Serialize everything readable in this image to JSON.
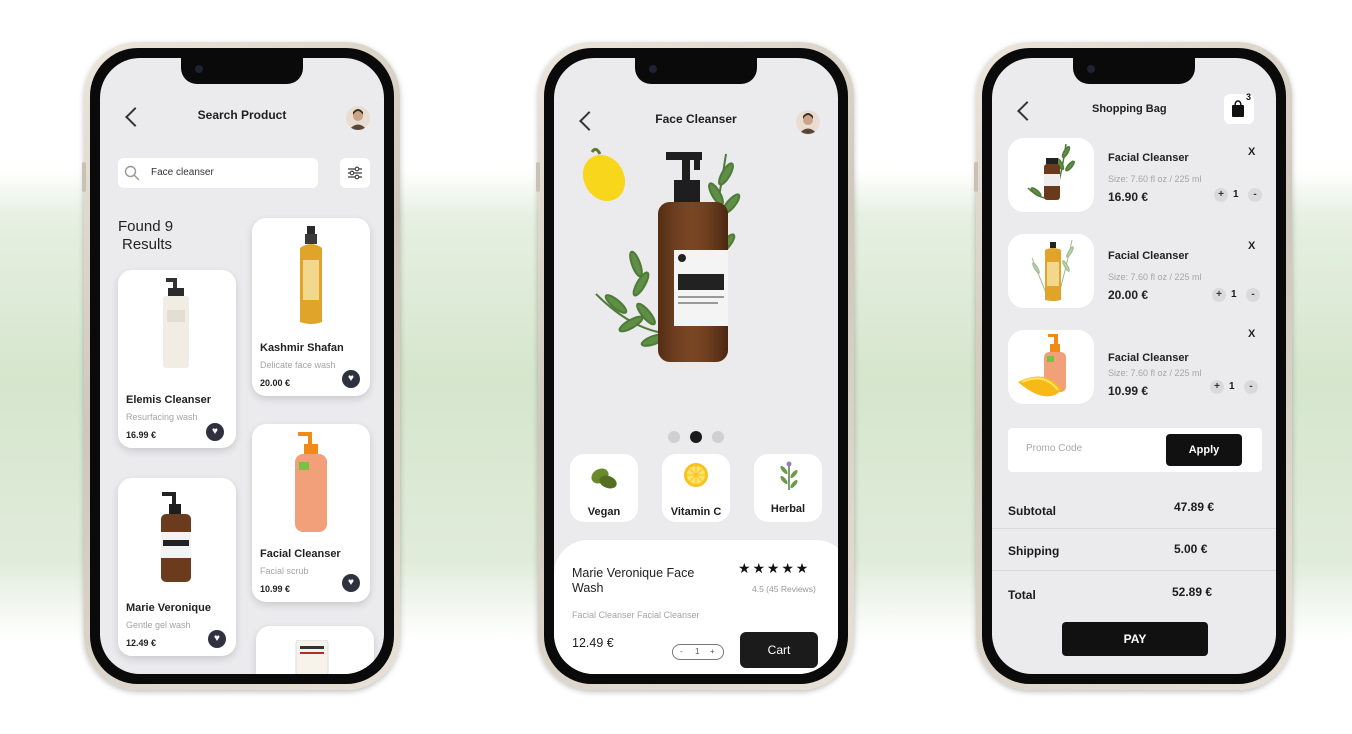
{
  "search_screen": {
    "title": "Search Product",
    "search_value": "Face cleanser",
    "results_line1": "Found 9",
    "results_line2": "Results",
    "products": [
      {
        "name": "Elemis Cleanser",
        "subtitle": "Resurfacing wash",
        "price": "16.99 €"
      },
      {
        "name": "Kashmir Shafan",
        "subtitle": "Delicate face wash",
        "price": "20.00 €"
      },
      {
        "name": "Marie Veronique",
        "subtitle": "Gentle gel wash",
        "price": "12.49 €"
      },
      {
        "name": "Facial Cleanser",
        "subtitle": "Facial scrub",
        "price": "10.99 €"
      }
    ]
  },
  "detail_screen": {
    "title": "Face Cleanser",
    "features": [
      {
        "label": "Vegan",
        "icon": "leaf-icon"
      },
      {
        "label": "Vitamin C",
        "icon": "lemon-slice-icon"
      },
      {
        "label": "Herbal",
        "icon": "herb-icon"
      }
    ],
    "carousel_active_index": 1,
    "product_name_line1": "Marie Veronique Face",
    "product_name_line2": "Wash",
    "stars": "★ ★ ★ ★ ★",
    "rating_value": 4.5,
    "rating_text": "4.5 (45 Reviews)",
    "category": "Facial Cleanser Facial Cleanser",
    "price": "12.49 €",
    "qty_minus": "-",
    "qty": "1",
    "qty_plus": "+",
    "cart_label": "Cart"
  },
  "bag_screen": {
    "title": "Shopping Bag",
    "bag_count": "3",
    "items": [
      {
        "name": "Facial Cleanser",
        "size": "Size: 7.60 fl oz / 225 ml",
        "price": "16.90 €",
        "qty": "1",
        "remove": "X"
      },
      {
        "name": "Facial Cleanser",
        "size": "Size: 7.60 fl oz / 225 ml",
        "price": "20.00 €",
        "qty": "1",
        "remove": "X"
      },
      {
        "name": "Facial Cleanser",
        "size": "Size: 7.60 fl oz / 225 ml",
        "price": "10.99 €",
        "qty": "1",
        "remove": "X"
      }
    ],
    "plus": "+",
    "minus": "-",
    "promo_placeholder": "Promo Code",
    "apply_label": "Apply",
    "subtotal_label": "Subtotal",
    "subtotal_value": "47.89 €",
    "shipping_label": "Shipping",
    "shipping_value": "5.00 €",
    "total_label": "Total",
    "total_value": "52.89 €",
    "pay_label": "PAY"
  },
  "colors": {
    "accent_dark": "#111111",
    "heart_button": "#2f3140",
    "screen_bg": "#ebebee"
  }
}
